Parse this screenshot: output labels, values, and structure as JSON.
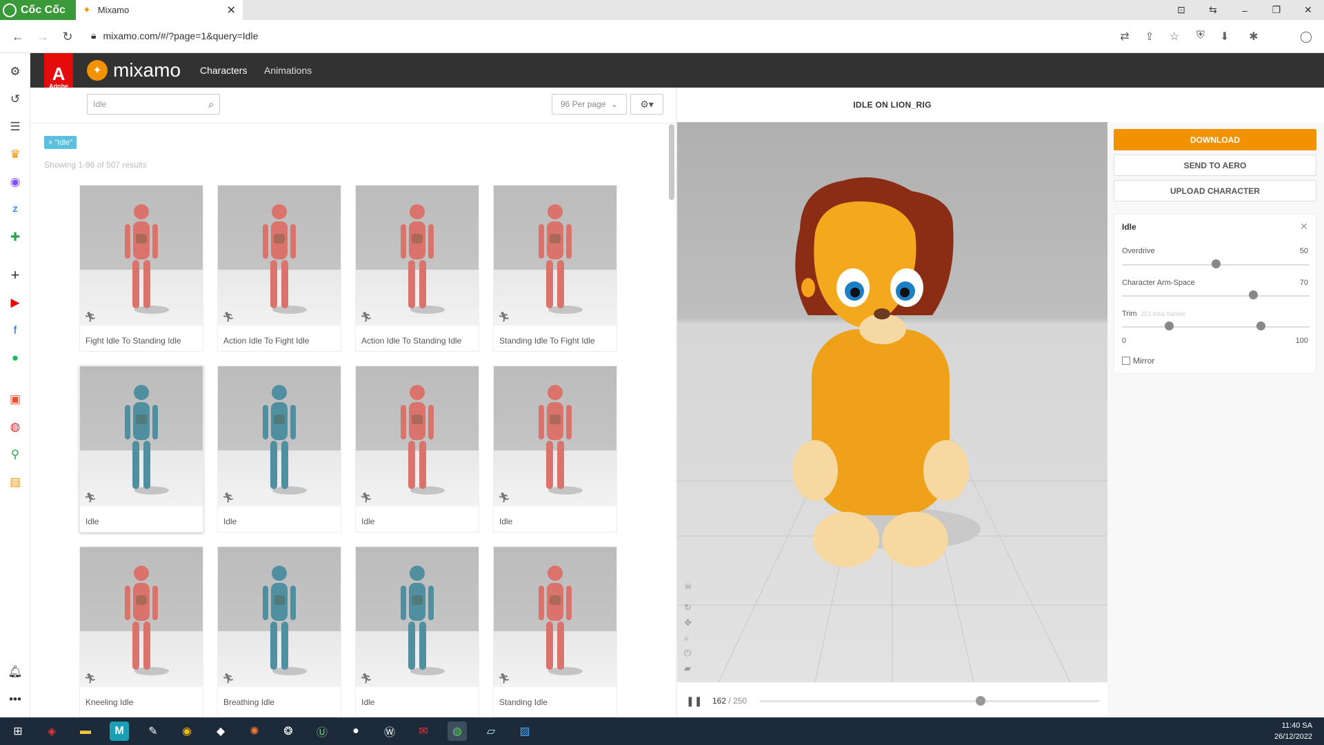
{
  "browser": {
    "brand": "Cốc Cốc",
    "tab_title": "Mixamo",
    "url": "mixamo.com/#/?page=1&query=Idle"
  },
  "app": {
    "adobe_label": "Adobe",
    "logo_text": "mixamo",
    "nav": [
      "Characters",
      "Animations"
    ]
  },
  "search": {
    "value": "Idle"
  },
  "per_page": "96 Per page",
  "filter_chip": "× \"Idle\"",
  "showing": "Showing 1-96 of 507 results",
  "cards": [
    {
      "label": "Fight Idle To Standing Idle",
      "color": "#d9736c"
    },
    {
      "label": "Action Idle To Fight Idle",
      "color": "#d9736c"
    },
    {
      "label": "Action Idle To Standing Idle",
      "color": "#d9736c"
    },
    {
      "label": "Standing Idle To Fight Idle",
      "color": "#d9736c"
    },
    {
      "label": "Idle",
      "color": "#4f8fa0"
    },
    {
      "label": "Idle",
      "color": "#4f8fa0"
    },
    {
      "label": "Idle",
      "color": "#d9736c"
    },
    {
      "label": "Idle",
      "color": "#d9736c"
    },
    {
      "label": "Kneeling Idle",
      "color": "#d9736c"
    },
    {
      "label": "Breathing Idle",
      "color": "#4f8fa0"
    },
    {
      "label": "Idle",
      "color": "#4f8fa0"
    },
    {
      "label": "Standing Idle",
      "color": "#d9736c"
    }
  ],
  "viewer": {
    "title": "IDLE ON LION_RIG",
    "frame_current": "162",
    "frame_total": "/ 250",
    "playback_progress": 0.65
  },
  "actions": {
    "download": "DOWNLOAD",
    "send_to_aero": "SEND TO AERO",
    "upload_character": "UPLOAD CHARACTER"
  },
  "settings": {
    "title": "Idle",
    "overdrive": {
      "label": "Overdrive",
      "value": "50",
      "fraction": 0.5
    },
    "arm_space": {
      "label": "Character Arm-Space",
      "value": "70",
      "fraction": 0.7
    },
    "trim": {
      "label": "Trim",
      "sub": "251 total frames",
      "min": "0",
      "max": "100",
      "start_fraction": 0.25,
      "end_fraction": 0.74
    },
    "mirror": "Mirror"
  },
  "taskbar": {
    "time": "11:40 SA",
    "date": "26/12/2022"
  },
  "colors": {
    "accent": "#f39200",
    "header": "#323232",
    "adobe_red": "#e30b0b",
    "chip": "#5bc0de"
  }
}
